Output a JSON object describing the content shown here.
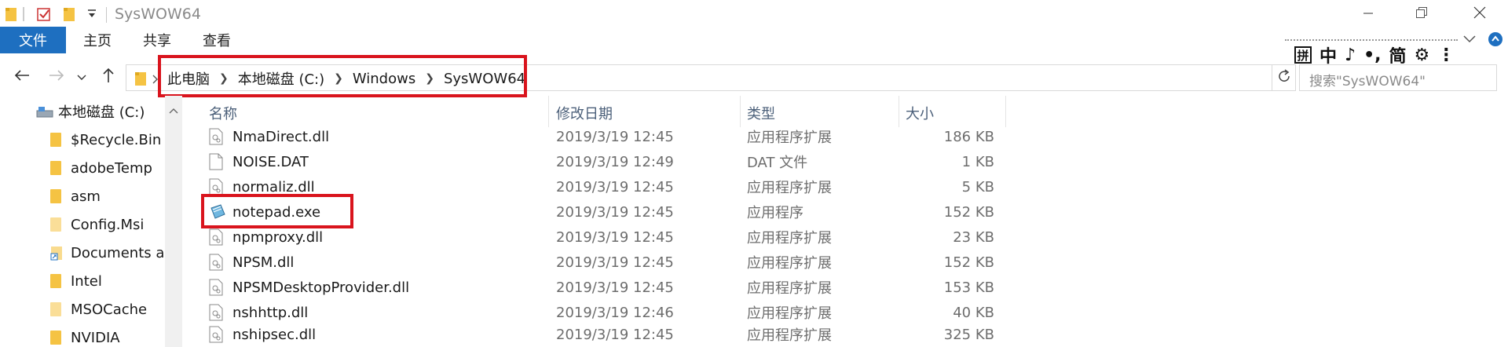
{
  "window": {
    "title": "SysWOW64",
    "minimize_icon": "minimize-icon",
    "maximize_icon": "restore-icon",
    "close_icon": "close-icon"
  },
  "ribbon": {
    "tabs": [
      {
        "label": "文件",
        "active": true
      },
      {
        "label": "主页"
      },
      {
        "label": "共享"
      },
      {
        "label": "查看"
      }
    ]
  },
  "ime": {
    "items": [
      "拼",
      "中",
      "♪",
      "•,",
      "简",
      "⚙",
      "⋮"
    ]
  },
  "navigation": {
    "breadcrumb": [
      "此电脑",
      "本地磁盘 (C:)",
      "Windows",
      "SysWOW64"
    ],
    "search_placeholder": "搜索\"SysWOW64\""
  },
  "sidebar": {
    "items": [
      {
        "label": "本地磁盘 (C:)",
        "icon": "drive-icon"
      },
      {
        "label": "$Recycle.Bin",
        "icon": "folder-icon"
      },
      {
        "label": "adobeTemp",
        "icon": "folder-icon"
      },
      {
        "label": "asm",
        "icon": "folder-icon"
      },
      {
        "label": "Config.Msi",
        "icon": "folder-icon"
      },
      {
        "label": "Documents and Settings",
        "icon": "shortcut-folder-icon"
      },
      {
        "label": "Intel",
        "icon": "folder-icon"
      },
      {
        "label": "MSOCache",
        "icon": "folder-icon"
      },
      {
        "label": "NVIDIA",
        "icon": "folder-icon"
      }
    ]
  },
  "columns": {
    "name": "名称",
    "date": "修改日期",
    "type": "类型",
    "size": "大小"
  },
  "files": [
    {
      "name": "NmaDirect.dll",
      "date": "2019/3/19 12:45",
      "type": "应用程序扩展",
      "size": "186 KB",
      "icon": "dll-icon"
    },
    {
      "name": "NOISE.DAT",
      "date": "2019/3/19 12:49",
      "type": "DAT 文件",
      "size": "1 KB",
      "icon": "file-icon"
    },
    {
      "name": "normaliz.dll",
      "date": "2019/3/19 12:45",
      "type": "应用程序扩展",
      "size": "5 KB",
      "icon": "dll-icon"
    },
    {
      "name": "notepad.exe",
      "date": "2019/3/19 12:45",
      "type": "应用程序",
      "size": "152 KB",
      "icon": "notepad-icon"
    },
    {
      "name": "npmproxy.dll",
      "date": "2019/3/19 12:45",
      "type": "应用程序扩展",
      "size": "23 KB",
      "icon": "dll-icon"
    },
    {
      "name": "NPSM.dll",
      "date": "2019/3/19 12:45",
      "type": "应用程序扩展",
      "size": "152 KB",
      "icon": "dll-icon"
    },
    {
      "name": "NPSMDesktopProvider.dll",
      "date": "2019/3/19 12:45",
      "type": "应用程序扩展",
      "size": "153 KB",
      "icon": "dll-icon"
    },
    {
      "name": "nshhttp.dll",
      "date": "2019/3/19 12:46",
      "type": "应用程序扩展",
      "size": "40 KB",
      "icon": "dll-icon"
    },
    {
      "name": "nshipsec.dll",
      "date": "2019/3/19 12:45",
      "type": "应用程序扩展",
      "size": "325 KB",
      "icon": "dll-icon"
    }
  ],
  "colors": {
    "accent": "#1e6fc0",
    "highlight": "#d9141d",
    "folder": "#f5c343"
  }
}
